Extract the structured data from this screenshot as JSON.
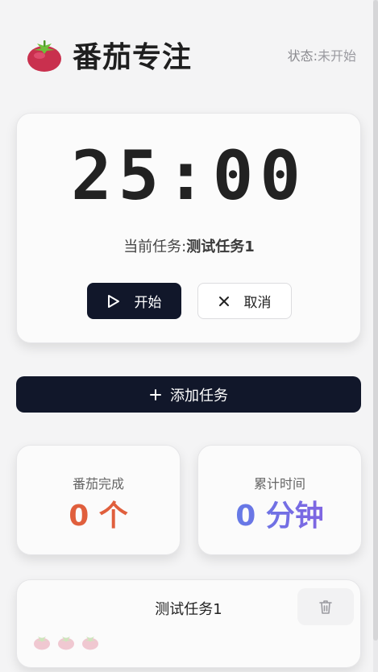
{
  "header": {
    "title": "番茄专注",
    "status_label": "状态:",
    "status_value": "未开始",
    "logo_icon": "tomato-icon"
  },
  "timer": {
    "display": "25:00",
    "current_task_label": "当前任务:",
    "current_task_name": "测试任务1",
    "start_label": "开始",
    "start_icon": "play-icon",
    "cancel_label": "取消",
    "cancel_icon": "close-icon"
  },
  "add_task": {
    "label": "添加任务",
    "icon": "plus-icon"
  },
  "stats": {
    "completed_label": "番茄完成",
    "completed_value": "0 个",
    "time_label": "累计时间",
    "time_value": "0 分钟"
  },
  "tasks": [
    {
      "name": "测试任务1",
      "estimated_pomodoros": 3,
      "delete_icon": "trash-icon"
    }
  ],
  "colors": {
    "primary_dark": "#11172a",
    "completed_accent": "#e05f3d",
    "time_gradient_start": "#5a83e8",
    "time_gradient_end": "#8a5ce0"
  }
}
